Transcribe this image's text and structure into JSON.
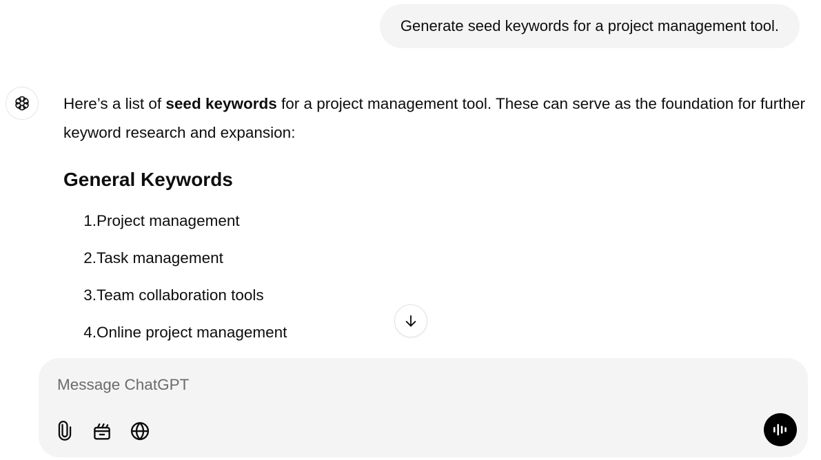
{
  "conversation": {
    "user_message": "Generate seed keywords for a project management tool.",
    "assistant": {
      "intro_before": "Here’s a list of ",
      "intro_bold": "seed keywords",
      "intro_after": " for a project management tool. These can serve as the foundation for further keyword research and expansion:",
      "section_heading": "General Keywords",
      "keywords": [
        {
          "num": "1.",
          "text": "Project management"
        },
        {
          "num": "2.",
          "text": "Task management"
        },
        {
          "num": "3.",
          "text": "Team collaboration tools"
        },
        {
          "num": "4.",
          "text": "Online project management"
        }
      ]
    }
  },
  "composer": {
    "placeholder": "Message ChatGPT",
    "value": "",
    "tools": [
      "paperclip-icon",
      "tools-icon",
      "globe-icon"
    ],
    "voice_icon": "voice-waveform-icon"
  },
  "icons": {
    "avatar": "chatgpt-logo-icon",
    "scroll": "arrow-down-icon"
  },
  "colors": {
    "bubble_bg": "#f4f4f4",
    "composer_bg": "#f4f4f4",
    "voice_button_bg": "#000000",
    "text": "#0d0d0d",
    "placeholder": "#6b6b6b"
  }
}
